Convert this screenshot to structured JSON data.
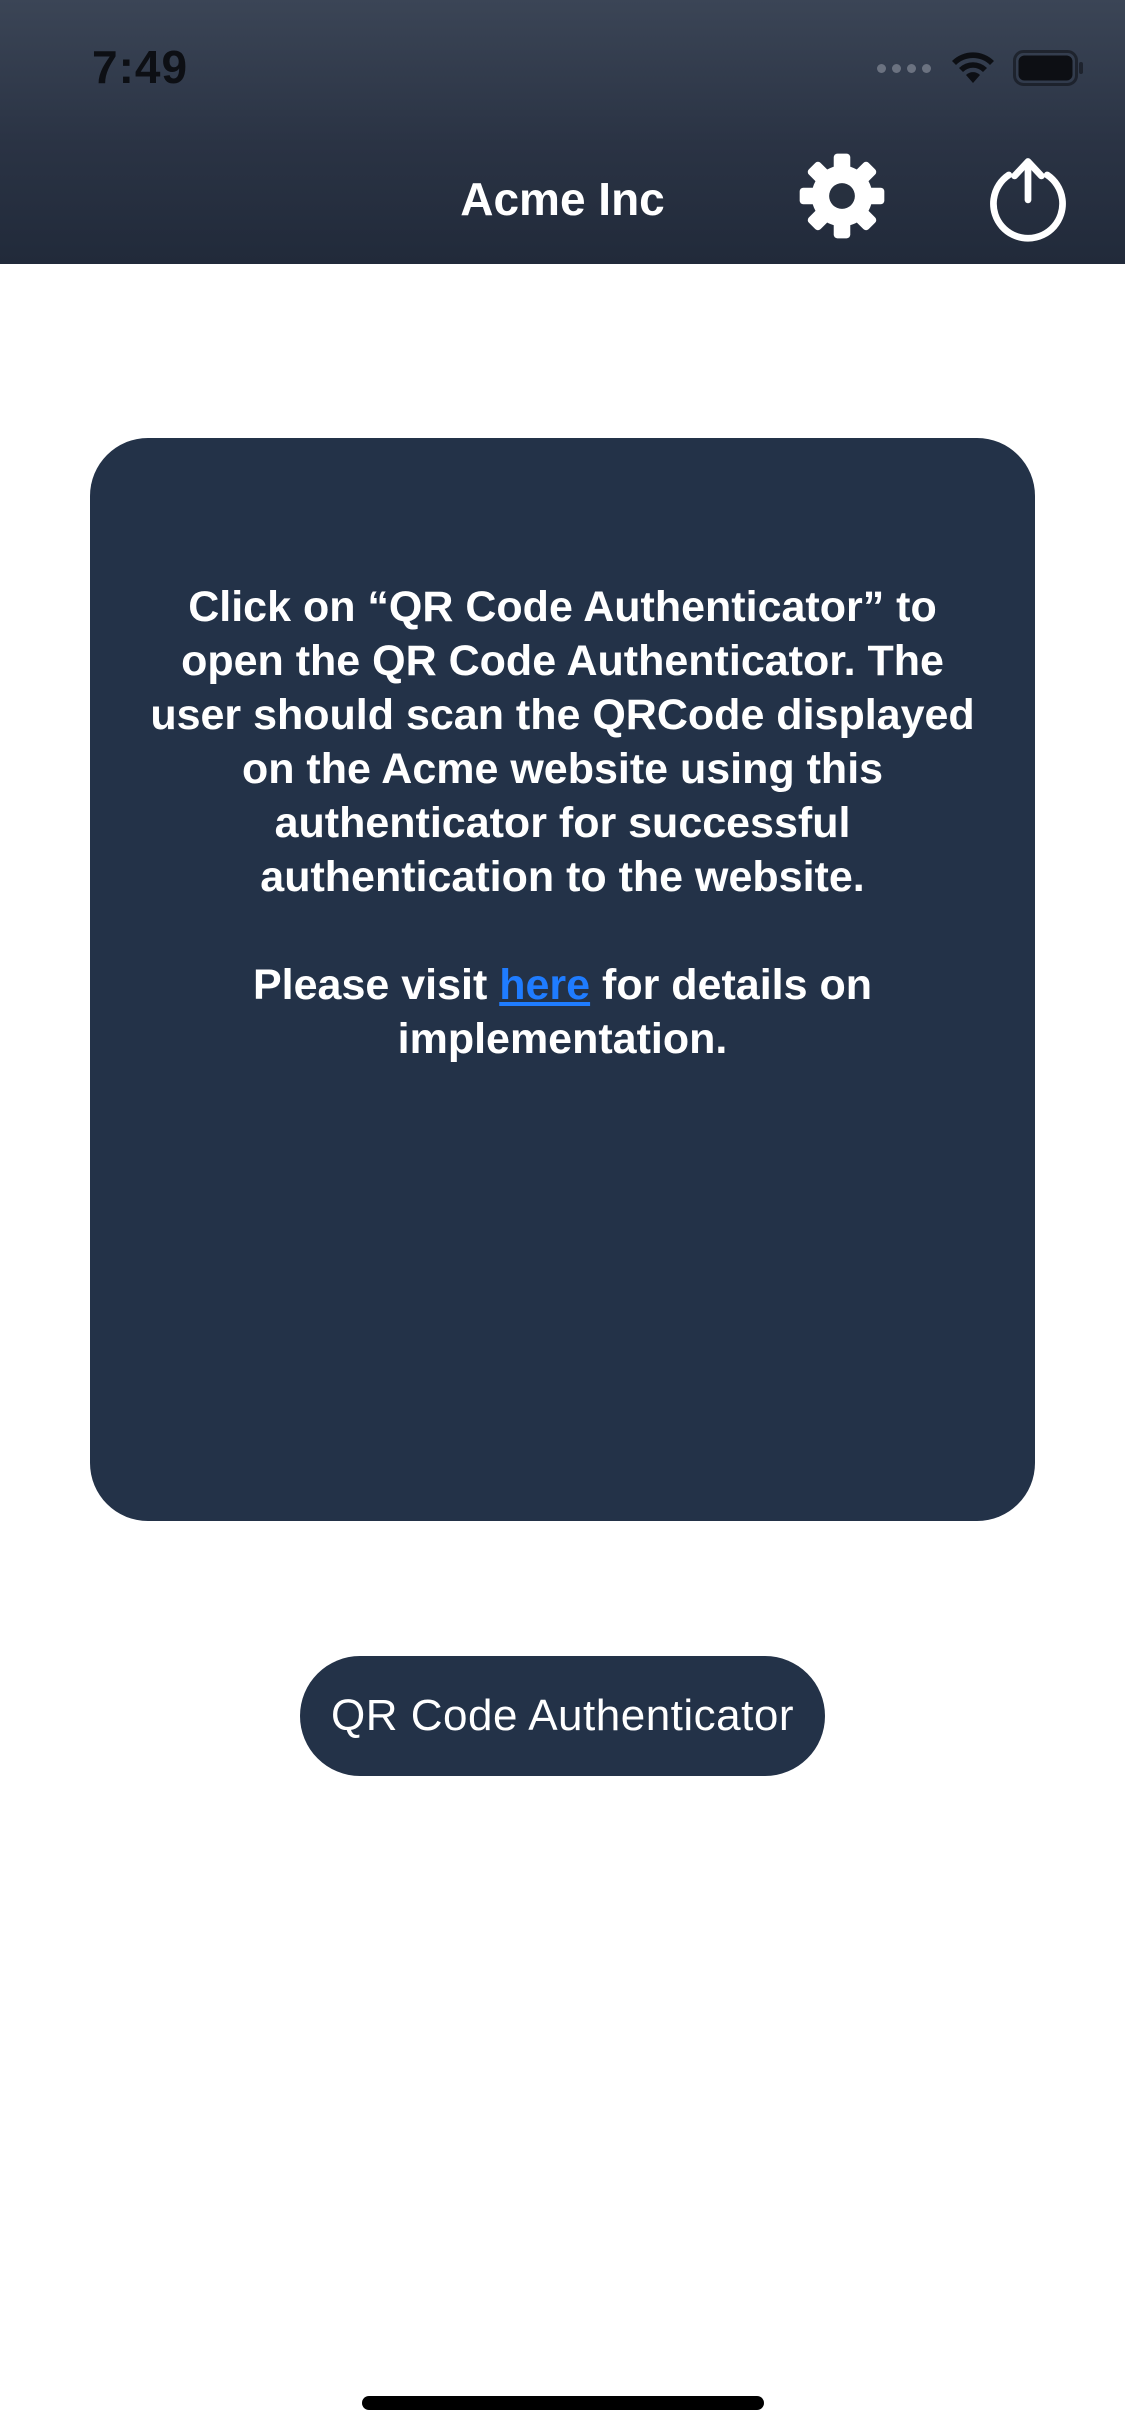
{
  "status_bar": {
    "time": "7:49",
    "icons": [
      "cellular-signal-icon",
      "wifi-icon",
      "battery-icon"
    ]
  },
  "nav_bar": {
    "title": "Acme Inc",
    "settings_icon": "gear-icon",
    "logout_icon": "power-icon"
  },
  "info_card": {
    "paragraph1": "Click on “QR Code Authenticator” to open the QR Code Authenticator. The user should scan the QRCode displayed on the Acme website using this authenticator for successful authentication to the website.",
    "paragraph2_prefix": "Please visit ",
    "link_text": "here",
    "paragraph2_suffix": " for details on implementation."
  },
  "actions": {
    "qr_button_label": "QR Code Authenticator"
  },
  "colors": {
    "header_top": "#3b4556",
    "header_bottom": "#212a3a",
    "card_bg": "#233248",
    "link": "#1f7cff",
    "background": "#ffffff"
  }
}
